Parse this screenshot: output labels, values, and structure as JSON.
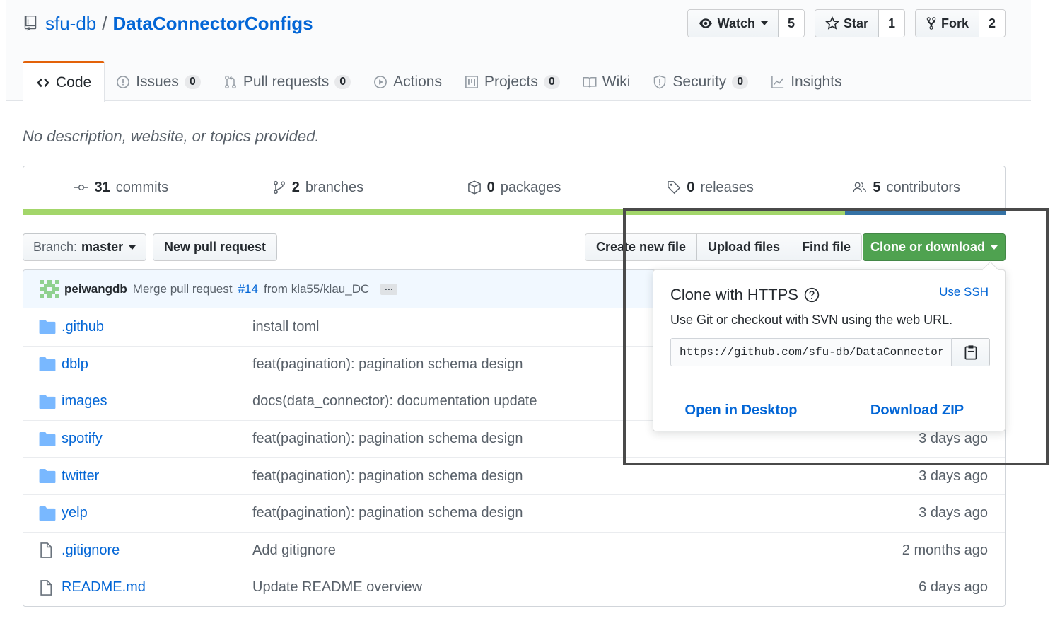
{
  "repo": {
    "owner": "sfu-db",
    "separator": "/",
    "name": "DataConnectorConfigs",
    "description": "No description, website, or topics provided."
  },
  "actions": {
    "watch": {
      "label": "Watch",
      "count": "5"
    },
    "star": {
      "label": "Star",
      "count": "1"
    },
    "fork": {
      "label": "Fork",
      "count": "2"
    }
  },
  "nav": {
    "code": {
      "label": "Code"
    },
    "issues": {
      "label": "Issues",
      "count": "0"
    },
    "pulls": {
      "label": "Pull requests",
      "count": "0"
    },
    "actions": {
      "label": "Actions"
    },
    "projects": {
      "label": "Projects",
      "count": "0"
    },
    "wiki": {
      "label": "Wiki"
    },
    "security": {
      "label": "Security",
      "count": "0"
    },
    "insights": {
      "label": "Insights"
    }
  },
  "summary": {
    "commits": {
      "count": "31",
      "label": "commits"
    },
    "branches": {
      "count": "2",
      "label": "branches"
    },
    "packages": {
      "count": "0",
      "label": "packages"
    },
    "releases": {
      "count": "0",
      "label": "releases"
    },
    "contributors": {
      "count": "5",
      "label": "contributors"
    }
  },
  "toolbar": {
    "branch_prefix": "Branch:",
    "branch_name": "master",
    "new_pr": "New pull request",
    "create_file": "Create new file",
    "upload_files": "Upload files",
    "find_file": "Find file",
    "clone": "Clone or download"
  },
  "latest_commit": {
    "author": "peiwangdb",
    "message_prefix": "Merge pull request",
    "pr_link": "#14",
    "message_suffix": "from kla55/klau_DC",
    "ellipsis": "···"
  },
  "files": [
    {
      "name": ".github",
      "type": "dir",
      "message": "install toml",
      "age": ""
    },
    {
      "name": "dblp",
      "type": "dir",
      "message": "feat(pagination): pagination schema design",
      "age": ""
    },
    {
      "name": "images",
      "type": "dir",
      "message": "docs(data_connector): documentation update",
      "age": ""
    },
    {
      "name": "spotify",
      "type": "dir",
      "message": "feat(pagination): pagination schema design",
      "age": "3 days ago"
    },
    {
      "name": "twitter",
      "type": "dir",
      "message": "feat(pagination): pagination schema design",
      "age": "3 days ago"
    },
    {
      "name": "yelp",
      "type": "dir",
      "message": "feat(pagination): pagination schema design",
      "age": "3 days ago"
    },
    {
      "name": ".gitignore",
      "type": "file",
      "message": "Add gitignore",
      "age": "2 months ago"
    },
    {
      "name": "README.md",
      "type": "file",
      "message": "Update README overview",
      "age": "6 days ago"
    }
  ],
  "clone_popover": {
    "title": "Clone with HTTPS",
    "use_ssh": "Use SSH",
    "description": "Use Git or checkout with SVN using the web URL.",
    "url": "https://github.com/sfu-db/DataConnectorConfigs.git",
    "open_desktop": "Open in Desktop",
    "download_zip": "Download ZIP"
  },
  "colors": {
    "link": "#0366d6",
    "clone_button": "#4fa250",
    "selected_tab_accent": "#e36209",
    "lang_primary": "#a3d66a",
    "lang_secondary": "#3572a5",
    "highlight_box": "#4a4a4a"
  },
  "language_bar": {
    "primary_fraction": 0.837,
    "secondary_fraction": 0.163
  }
}
